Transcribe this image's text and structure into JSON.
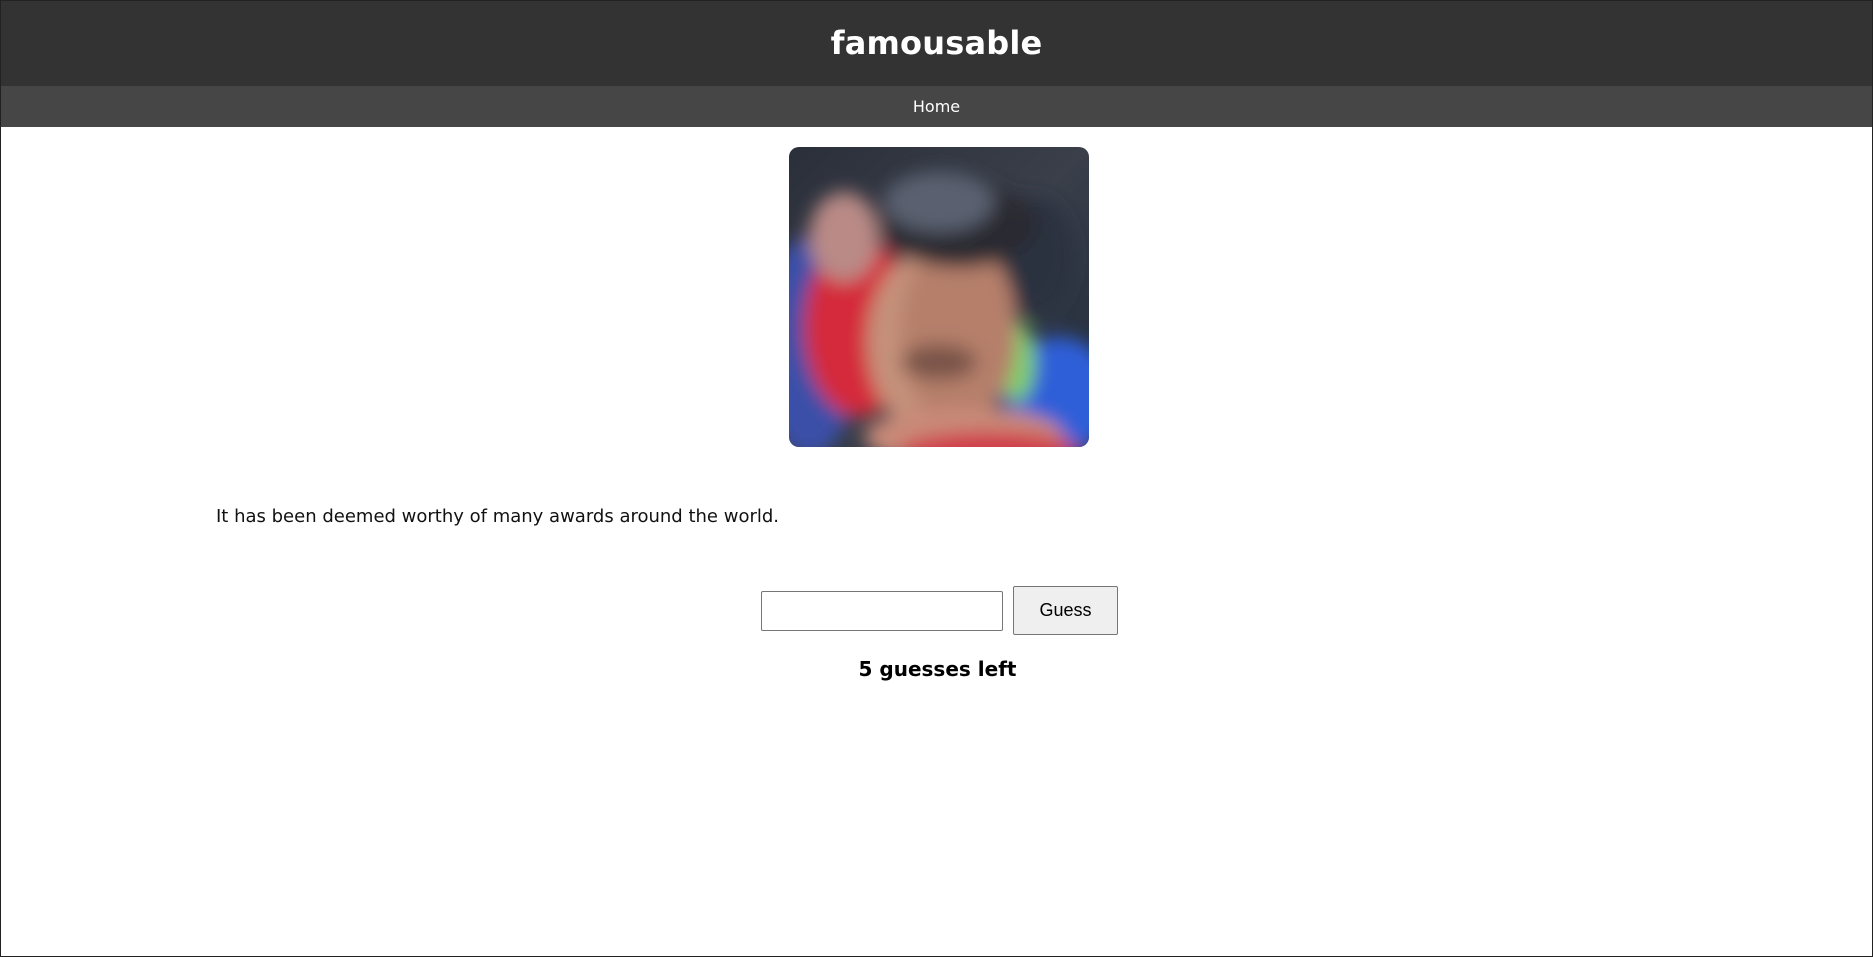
{
  "header": {
    "title": "famousable"
  },
  "nav": {
    "home_label": "Home"
  },
  "celebrity_photo": {
    "icon": "blurred-celebrity-photo",
    "state": "blurred"
  },
  "hint": {
    "text": "It has been deemed worthy of many awards around the world."
  },
  "guess_form": {
    "input_value": "",
    "input_placeholder": "",
    "button_label": "Guess"
  },
  "status": {
    "guesses_left_text": "5 guesses left"
  },
  "colors": {
    "header_bg": "#333333",
    "nav_bg": "#464646",
    "page_bg": "#ffffff",
    "button_bg": "#efefef"
  }
}
